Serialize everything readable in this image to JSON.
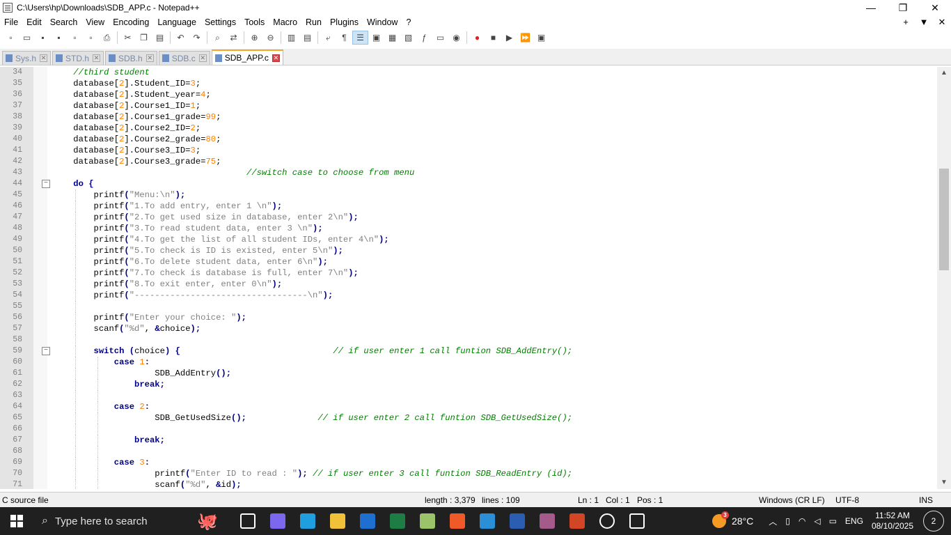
{
  "window": {
    "title": "C:\\Users\\hp\\Downloads\\SDB_APP.c - Notepad++"
  },
  "menu": [
    "File",
    "Edit",
    "Search",
    "View",
    "Encoding",
    "Language",
    "Settings",
    "Tools",
    "Macro",
    "Run",
    "Plugins",
    "Window",
    "?"
  ],
  "menu_right": [
    "+",
    "▼",
    "✕"
  ],
  "tabs": [
    {
      "label": "Sys.h",
      "active": false
    },
    {
      "label": "STD.h",
      "active": false
    },
    {
      "label": "SDB.h",
      "active": false
    },
    {
      "label": "SDB.c",
      "active": false
    },
    {
      "label": "SDB_APP.c",
      "active": true
    }
  ],
  "editor": {
    "lines": [
      {
        "n": "34",
        "indent": 1,
        "fold": "",
        "tokens": [
          [
            "c",
            "//third student"
          ]
        ]
      },
      {
        "n": "35",
        "indent": 1,
        "fold": "",
        "tokens": [
          [
            "p",
            "database["
          ],
          [
            "n",
            "2"
          ],
          [
            "p",
            "].Student_ID="
          ],
          [
            "n",
            "3"
          ],
          [
            "p",
            ";"
          ]
        ]
      },
      {
        "n": "36",
        "indent": 1,
        "fold": "",
        "tokens": [
          [
            "p",
            "database["
          ],
          [
            "n",
            "2"
          ],
          [
            "p",
            "].Student_year="
          ],
          [
            "n",
            "4"
          ],
          [
            "p",
            ";"
          ]
        ]
      },
      {
        "n": "37",
        "indent": 1,
        "fold": "",
        "tokens": [
          [
            "p",
            "database["
          ],
          [
            "n",
            "2"
          ],
          [
            "p",
            "].Course1_ID="
          ],
          [
            "n",
            "1"
          ],
          [
            "p",
            ";"
          ]
        ]
      },
      {
        "n": "38",
        "indent": 1,
        "fold": "",
        "tokens": [
          [
            "p",
            "database["
          ],
          [
            "n",
            "2"
          ],
          [
            "p",
            "].Course1_grade="
          ],
          [
            "n",
            "99"
          ],
          [
            "p",
            ";"
          ]
        ]
      },
      {
        "n": "39",
        "indent": 1,
        "fold": "",
        "tokens": [
          [
            "p",
            "database["
          ],
          [
            "n",
            "2"
          ],
          [
            "p",
            "].Course2_ID="
          ],
          [
            "n",
            "2"
          ],
          [
            "p",
            ";"
          ]
        ]
      },
      {
        "n": "40",
        "indent": 1,
        "fold": "",
        "tokens": [
          [
            "p",
            "database["
          ],
          [
            "n",
            "2"
          ],
          [
            "p",
            "].Course2_grade="
          ],
          [
            "n",
            "80"
          ],
          [
            "p",
            ";"
          ]
        ]
      },
      {
        "n": "41",
        "indent": 1,
        "fold": "",
        "tokens": [
          [
            "p",
            "database["
          ],
          [
            "n",
            "2"
          ],
          [
            "p",
            "].Course3_ID="
          ],
          [
            "n",
            "3"
          ],
          [
            "p",
            ";"
          ]
        ]
      },
      {
        "n": "42",
        "indent": 1,
        "fold": "",
        "tokens": [
          [
            "p",
            "database["
          ],
          [
            "n",
            "2"
          ],
          [
            "p",
            "].Course3_grade="
          ],
          [
            "n",
            "75"
          ],
          [
            "p",
            ";"
          ]
        ]
      },
      {
        "n": "43",
        "indent": 1,
        "fold": "",
        "tokens": [
          [
            "p",
            "                                  "
          ],
          [
            "c",
            "//switch case to choose from menu"
          ]
        ]
      },
      {
        "n": "44",
        "indent": 1,
        "fold": "−",
        "tokens": [
          [
            "k",
            "do"
          ],
          [
            "p",
            " "
          ],
          [
            "o",
            "{"
          ]
        ]
      },
      {
        "n": "45",
        "indent": 2,
        "fold": "",
        "tokens": [
          [
            "p",
            "    printf"
          ],
          [
            "o",
            "("
          ],
          [
            "s",
            "\"Menu:\\n\""
          ],
          [
            "o",
            ");"
          ]
        ]
      },
      {
        "n": "46",
        "indent": 2,
        "fold": "",
        "tokens": [
          [
            "p",
            "    printf"
          ],
          [
            "o",
            "("
          ],
          [
            "s",
            "\"1.To add entry, enter 1 \\n\""
          ],
          [
            "o",
            ");"
          ]
        ]
      },
      {
        "n": "47",
        "indent": 2,
        "fold": "",
        "tokens": [
          [
            "p",
            "    printf"
          ],
          [
            "o",
            "("
          ],
          [
            "s",
            "\"2.To get used size in database, enter 2\\n\""
          ],
          [
            "o",
            ");"
          ]
        ]
      },
      {
        "n": "48",
        "indent": 2,
        "fold": "",
        "tokens": [
          [
            "p",
            "    printf"
          ],
          [
            "o",
            "("
          ],
          [
            "s",
            "\"3.To read student data, enter 3 \\n\""
          ],
          [
            "o",
            ");"
          ]
        ]
      },
      {
        "n": "49",
        "indent": 2,
        "fold": "",
        "tokens": [
          [
            "p",
            "    printf"
          ],
          [
            "o",
            "("
          ],
          [
            "s",
            "\"4.To get the list of all student IDs, enter 4\\n\""
          ],
          [
            "o",
            ");"
          ]
        ]
      },
      {
        "n": "50",
        "indent": 2,
        "fold": "",
        "tokens": [
          [
            "p",
            "    printf"
          ],
          [
            "o",
            "("
          ],
          [
            "s",
            "\"5.To check is ID is existed, enter 5\\n\""
          ],
          [
            "o",
            ");"
          ]
        ]
      },
      {
        "n": "51",
        "indent": 2,
        "fold": "",
        "tokens": [
          [
            "p",
            "    printf"
          ],
          [
            "o",
            "("
          ],
          [
            "s",
            "\"6.To delete student data, enter 6\\n\""
          ],
          [
            "o",
            ");"
          ]
        ]
      },
      {
        "n": "52",
        "indent": 2,
        "fold": "",
        "tokens": [
          [
            "p",
            "    printf"
          ],
          [
            "o",
            "("
          ],
          [
            "s",
            "\"7.To check is database is full, enter 7\\n\""
          ],
          [
            "o",
            ");"
          ]
        ]
      },
      {
        "n": "53",
        "indent": 2,
        "fold": "",
        "tokens": [
          [
            "p",
            "    printf"
          ],
          [
            "o",
            "("
          ],
          [
            "s",
            "\"8.To exit enter, enter 0\\n\""
          ],
          [
            "o",
            ");"
          ]
        ]
      },
      {
        "n": "54",
        "indent": 2,
        "fold": "",
        "tokens": [
          [
            "p",
            "    printf"
          ],
          [
            "o",
            "("
          ],
          [
            "s",
            "\"----------------------------------\\n\""
          ],
          [
            "o",
            ");"
          ]
        ]
      },
      {
        "n": "55",
        "indent": 2,
        "fold": "",
        "tokens": []
      },
      {
        "n": "56",
        "indent": 2,
        "fold": "",
        "tokens": [
          [
            "p",
            "    printf"
          ],
          [
            "o",
            "("
          ],
          [
            "s",
            "\"Enter your choice: \""
          ],
          [
            "o",
            ");"
          ]
        ]
      },
      {
        "n": "57",
        "indent": 2,
        "fold": "",
        "tokens": [
          [
            "p",
            "    scanf"
          ],
          [
            "o",
            "("
          ],
          [
            "s",
            "\"%d\""
          ],
          [
            "p",
            ", "
          ],
          [
            "o",
            "&"
          ],
          [
            "p",
            "choice"
          ],
          [
            "o",
            ");"
          ]
        ]
      },
      {
        "n": "58",
        "indent": 2,
        "fold": "",
        "tokens": []
      },
      {
        "n": "59",
        "indent": 2,
        "fold": "−",
        "tokens": [
          [
            "p",
            "    "
          ],
          [
            "k",
            "switch"
          ],
          [
            "p",
            " "
          ],
          [
            "o",
            "("
          ],
          [
            "p",
            "choice"
          ],
          [
            "o",
            ")"
          ],
          [
            "p",
            " "
          ],
          [
            "o",
            "{"
          ],
          [
            "p",
            "                              "
          ],
          [
            "c",
            "// if user enter 1 call funtion SDB_AddEntry();"
          ]
        ]
      },
      {
        "n": "60",
        "indent": 3,
        "fold": "",
        "tokens": [
          [
            "p",
            "        "
          ],
          [
            "k",
            "case"
          ],
          [
            "p",
            " "
          ],
          [
            "n",
            "1"
          ],
          [
            "o",
            ":"
          ]
        ]
      },
      {
        "n": "61",
        "indent": 3,
        "fold": "",
        "tokens": [
          [
            "p",
            "                SDB_AddEntry"
          ],
          [
            "o",
            "();"
          ]
        ]
      },
      {
        "n": "62",
        "indent": 3,
        "fold": "",
        "tokens": [
          [
            "p",
            "            "
          ],
          [
            "k",
            "break"
          ],
          [
            "o",
            ";"
          ]
        ]
      },
      {
        "n": "63",
        "indent": 3,
        "fold": "",
        "tokens": []
      },
      {
        "n": "64",
        "indent": 3,
        "fold": "",
        "tokens": [
          [
            "p",
            "        "
          ],
          [
            "k",
            "case"
          ],
          [
            "p",
            " "
          ],
          [
            "n",
            "2"
          ],
          [
            "o",
            ":"
          ]
        ]
      },
      {
        "n": "65",
        "indent": 3,
        "fold": "",
        "tokens": [
          [
            "p",
            "                SDB_GetUsedSize"
          ],
          [
            "o",
            "();"
          ],
          [
            "p",
            "              "
          ],
          [
            "c",
            "// if user enter 2 call funtion SDB_GetUsedSize();"
          ]
        ]
      },
      {
        "n": "66",
        "indent": 3,
        "fold": "",
        "tokens": []
      },
      {
        "n": "67",
        "indent": 3,
        "fold": "",
        "tokens": [
          [
            "p",
            "            "
          ],
          [
            "k",
            "break"
          ],
          [
            "o",
            ";"
          ]
        ]
      },
      {
        "n": "68",
        "indent": 3,
        "fold": "",
        "tokens": []
      },
      {
        "n": "69",
        "indent": 3,
        "fold": "",
        "tokens": [
          [
            "p",
            "        "
          ],
          [
            "k",
            "case"
          ],
          [
            "p",
            " "
          ],
          [
            "n",
            "3"
          ],
          [
            "o",
            ":"
          ]
        ]
      },
      {
        "n": "70",
        "indent": 3,
        "fold": "",
        "tokens": [
          [
            "p",
            "                printf"
          ],
          [
            "o",
            "("
          ],
          [
            "s",
            "\"Enter ID to read : \""
          ],
          [
            "o",
            ");"
          ],
          [
            "p",
            " "
          ],
          [
            "c",
            "// if user enter 3 call funtion SDB_ReadEntry (id);"
          ]
        ]
      },
      {
        "n": "71",
        "indent": 3,
        "fold": "",
        "tokens": [
          [
            "p",
            "                scanf"
          ],
          [
            "o",
            "("
          ],
          [
            "s",
            "\"%d\""
          ],
          [
            "p",
            ", "
          ],
          [
            "o",
            "&"
          ],
          [
            "p",
            "id"
          ],
          [
            "o",
            ");"
          ]
        ]
      }
    ]
  },
  "status": {
    "filetype": "C source file",
    "length": "length : 3,379",
    "lines": "lines : 109",
    "ln": "Ln : 1",
    "col": "Col : 1",
    "pos": "Pos : 1",
    "eol": "Windows (CR LF)",
    "encoding": "UTF-8",
    "mode": "INS"
  },
  "taskbar": {
    "search_placeholder": "Type here to search",
    "weather": "28°C",
    "weather_badge": "3",
    "language": "ENG",
    "time": "11:52 AM",
    "date": "08/10/2025",
    "notifications": "2",
    "apps": [
      {
        "name": "task-view-icon",
        "color": "#202020"
      },
      {
        "name": "copilot-icon",
        "color": "#7b68ee"
      },
      {
        "name": "edge-icon",
        "color": "#1f9ee0"
      },
      {
        "name": "file-explorer-icon",
        "color": "#f2c13a"
      },
      {
        "name": "mail-icon",
        "color": "#1f6fd1"
      },
      {
        "name": "excel-icon",
        "color": "#1e7d45"
      },
      {
        "name": "notepadpp-icon",
        "color": "#9bc36a"
      },
      {
        "name": "brave-icon",
        "color": "#f05a28"
      },
      {
        "name": "vscode-icon",
        "color": "#2a8fd6"
      },
      {
        "name": "word-icon",
        "color": "#2b5eb3"
      },
      {
        "name": "winrar-icon",
        "color": "#a55a8c"
      },
      {
        "name": "powerpoint-icon",
        "color": "#d24625"
      },
      {
        "name": "settings-icon",
        "color": "#202020"
      },
      {
        "name": "photos-icon",
        "color": "#202020"
      }
    ]
  }
}
